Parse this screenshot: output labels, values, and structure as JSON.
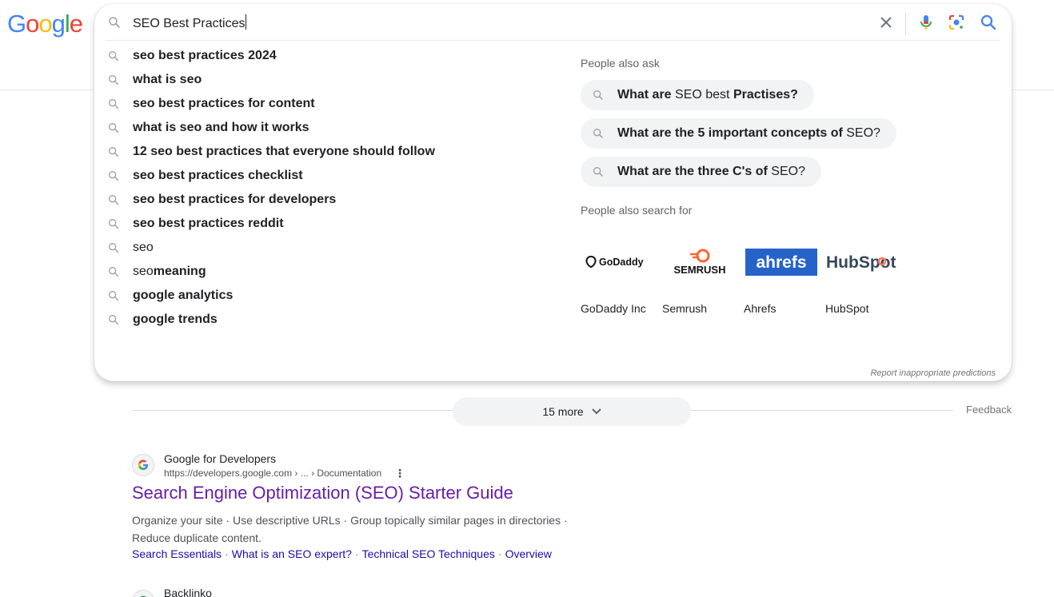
{
  "logo": {
    "letters": [
      "G",
      "o",
      "o",
      "g",
      "l",
      "e"
    ],
    "colors": [
      "#4285F4",
      "#EA4335",
      "#FBBC05",
      "#4285F4",
      "#34A853",
      "#EA4335"
    ]
  },
  "search": {
    "query": "SEO Best Practices"
  },
  "suggestions": [
    {
      "prefix": "",
      "bold": "seo best practices 2024"
    },
    {
      "prefix": "",
      "bold": "what is seo"
    },
    {
      "prefix": "",
      "bold": "seo best practices for content"
    },
    {
      "prefix": "",
      "bold": "what is seo and how it works"
    },
    {
      "prefix": "",
      "bold": "12 seo best practices that everyone should follow"
    },
    {
      "prefix": "",
      "bold": "seo best practices checklist"
    },
    {
      "prefix": "",
      "bold": "seo best practices for developers"
    },
    {
      "prefix": "",
      "bold": "seo best practices reddit"
    },
    {
      "prefix": "seo",
      "bold": ""
    },
    {
      "prefix": "seo ",
      "bold": "meaning"
    },
    {
      "prefix": "",
      "bold": "google analytics"
    },
    {
      "prefix": "",
      "bold": "google trends"
    }
  ],
  "people_also_ask": {
    "title": "People also ask",
    "questions": [
      {
        "b1": "What are",
        "n1": " SEO best ",
        "b2": "Practises?",
        "n2": ""
      },
      {
        "b1": "What are the 5 important concepts of",
        "n1": " SEO?",
        "b2": "",
        "n2": ""
      },
      {
        "b1": "What are the three C's of",
        "n1": " SEO?",
        "b2": "",
        "n2": ""
      }
    ]
  },
  "people_also_search": {
    "title": "People also search for",
    "brands": [
      {
        "name": "GoDaddy Inc",
        "logo_text": "GoDaddy"
      },
      {
        "name": "Semrush",
        "logo_text": "SEMRUSH"
      },
      {
        "name": "Ahrefs",
        "logo_text": "ahrefs"
      },
      {
        "name": "HubSpot",
        "logo_text": "HubSpot"
      }
    ]
  },
  "report_link": "Report inappropriate predictions",
  "more_button": "15 more",
  "feedback": "Feedback",
  "results": [
    {
      "site_name": "Google for Developers",
      "url": "https://developers.google.com › ... › Documentation",
      "title": "Search Engine Optimization (SEO) Starter Guide",
      "snippet": "Organize your site · Use descriptive URLs · Group topically similar pages in directories · Reduce duplicate content.",
      "links": [
        "Search Essentials",
        "What is an SEO expert?",
        "Technical SEO Techniques",
        "Overview"
      ]
    },
    {
      "site_name": "Backlinko"
    }
  ],
  "colors": {
    "link": "#1a0dab",
    "visited": "#681da8",
    "ahrefs_bg": "#2563c9",
    "ahrefs_accent": "#ff8800",
    "semrush_orange": "#ff642d",
    "hubspot_orange": "#ff7a59"
  }
}
